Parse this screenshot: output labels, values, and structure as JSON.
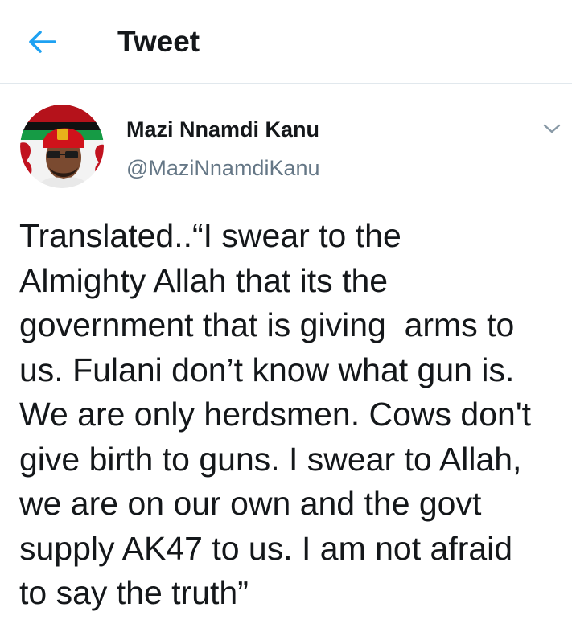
{
  "header": {
    "title": "Tweet",
    "back_icon": "arrow-left-icon",
    "accent_color": "#1da1f2"
  },
  "tweet": {
    "author_name": "Mazi Nnamdi Kanu",
    "author_handle": "@MaziNnamdiKanu",
    "menu_icon": "chevron-down-icon",
    "text": "Translated..“I swear to the\nAlmighty Allah that its the\ngovernment that is giving  arms to\nus. Fulani don’t know what gun is.\nWe are only herdsmen. Cows don't\ngive birth to guns. I swear to Allah,\nwe are on our own and the govt\nsupply AK47 to us. I am not afraid\nto say the truth”"
  },
  "colors": {
    "text_primary": "#14171a",
    "text_secondary": "#657786",
    "divider": "#e1e8ed"
  }
}
